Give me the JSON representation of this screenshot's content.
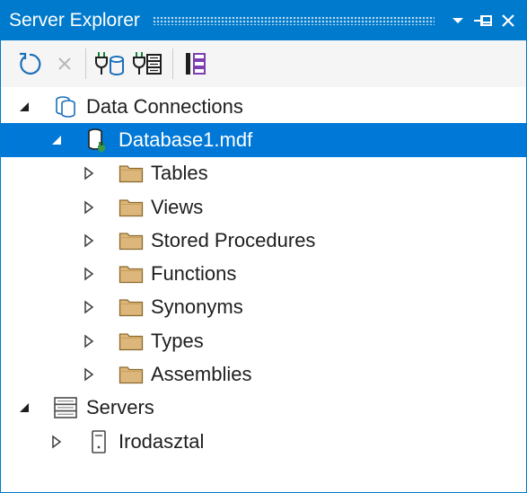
{
  "window": {
    "title": "Server Explorer",
    "accent": "#007acc",
    "selection": "#0078d7"
  },
  "title_buttons": [
    {
      "name": "dropdown",
      "icon": "chevron-down-icon"
    },
    {
      "name": "pin",
      "icon": "pin-icon"
    },
    {
      "name": "close",
      "icon": "close-icon"
    }
  ],
  "toolbar": {
    "buttons": [
      {
        "name": "refresh",
        "icon": "refresh-icon",
        "enabled": true
      },
      {
        "name": "stop",
        "icon": "stop-icon",
        "enabled": false
      },
      {
        "name": "connect-to-database",
        "icon": "connect-database-icon",
        "enabled": true
      },
      {
        "name": "connect-to-server",
        "icon": "connect-server-icon",
        "enabled": true
      },
      {
        "name": "sharepoint-connections",
        "icon": "hierarchy-icon",
        "enabled": true
      }
    ]
  },
  "tree": [
    {
      "label": "Data Connections",
      "icon": "data-connections-icon",
      "expander": "expanded",
      "level": 0
    },
    {
      "label": "Database1.mdf",
      "icon": "database-icon",
      "expander": "expanded",
      "level": 1,
      "selected": true
    },
    {
      "label": "Tables",
      "icon": "folder-icon",
      "expander": "collapsed",
      "level": 2
    },
    {
      "label": "Views",
      "icon": "folder-icon",
      "expander": "collapsed",
      "level": 2
    },
    {
      "label": "Stored Procedures",
      "icon": "folder-icon",
      "expander": "collapsed",
      "level": 2
    },
    {
      "label": "Functions",
      "icon": "folder-icon",
      "expander": "collapsed",
      "level": 2
    },
    {
      "label": "Synonyms",
      "icon": "folder-icon",
      "expander": "collapsed",
      "level": 2
    },
    {
      "label": "Types",
      "icon": "folder-icon",
      "expander": "collapsed",
      "level": 2
    },
    {
      "label": "Assemblies",
      "icon": "folder-icon",
      "expander": "collapsed",
      "level": 2
    },
    {
      "label": "Servers",
      "icon": "servers-icon",
      "expander": "expanded",
      "level": 0
    },
    {
      "label": "Irodasztal",
      "icon": "computer-icon",
      "expander": "collapsed",
      "level": 1
    }
  ]
}
